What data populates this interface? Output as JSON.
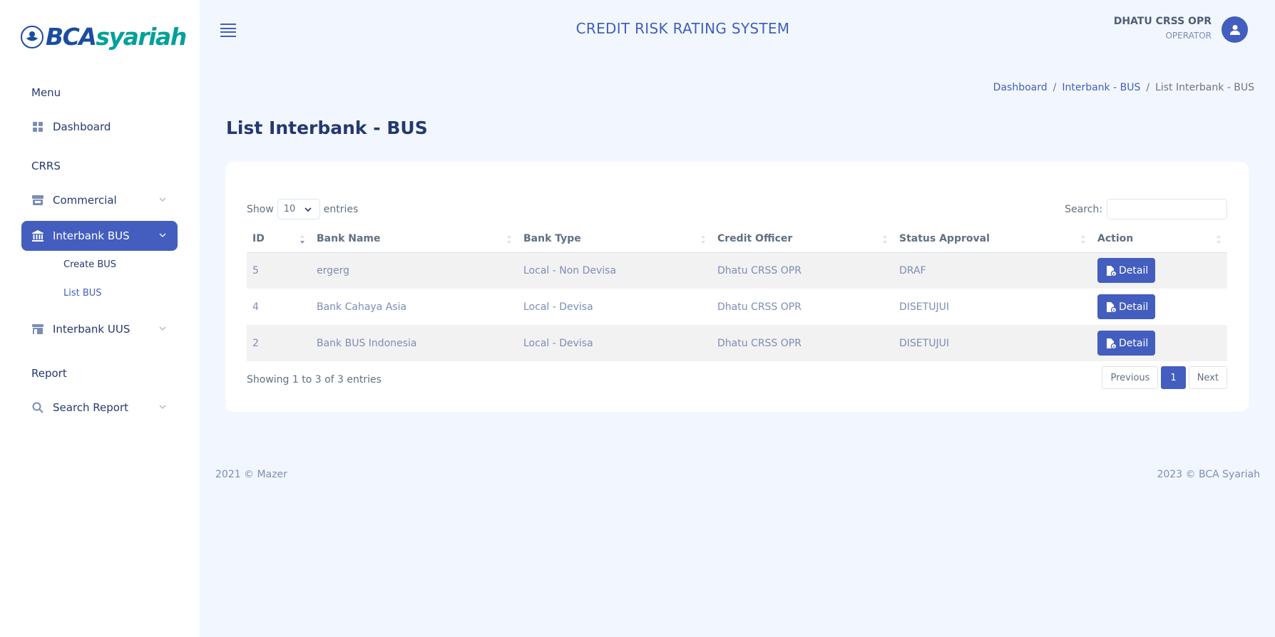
{
  "brand": {
    "bca": "BCA",
    "syariah": "syariah"
  },
  "header": {
    "title": "CREDIT RISK RATING SYSTEM",
    "user_name": "DHATU CRSS OPR",
    "user_role": "OPERATOR"
  },
  "sidebar": {
    "section_menu": "Menu",
    "dashboard": "Dashboard",
    "section_crrs": "CRRS",
    "commercial": "Commercial",
    "interbank_bus": "Interbank BUS",
    "create_bus": "Create BUS",
    "list_bus": "List BUS",
    "interbank_uus": "Interbank UUS",
    "section_report": "Report",
    "search_report": "Search Report"
  },
  "breadcrumb": {
    "item1": "Dashboard",
    "sep": "/",
    "item2": "Interbank - BUS",
    "item3": "List Interbank - BUS"
  },
  "page_title": "List Interbank - BUS",
  "table_controls": {
    "show": "Show",
    "entries_value": "10",
    "entries": "entries",
    "search_label": "Search:"
  },
  "table": {
    "headers": [
      "ID",
      "Bank Name",
      "Bank Type",
      "Credit Officer",
      "Status Approval",
      "Action"
    ],
    "rows": [
      {
        "id": "5",
        "bank_name": "ergerg",
        "bank_type": "Local - Non Devisa",
        "officer": "Dhatu CRSS OPR",
        "status": "DRAF",
        "action": "Detail"
      },
      {
        "id": "4",
        "bank_name": "Bank Cahaya Asia",
        "bank_type": "Local - Devisa",
        "officer": "Dhatu CRSS OPR",
        "status": "DISETUJUI",
        "action": "Detail"
      },
      {
        "id": "2",
        "bank_name": "Bank BUS Indonesia",
        "bank_type": "Local - Devisa",
        "officer": "Dhatu CRSS OPR",
        "status": "DISETUJUI",
        "action": "Detail"
      }
    ]
  },
  "table_info": "Showing 1 to 3 of 3 entries",
  "pagination": {
    "previous": "Previous",
    "page": "1",
    "next": "Next"
  },
  "footer": {
    "left": "2021 © Mazer",
    "right": "2023 © BCA Syariah"
  },
  "colors": {
    "primary": "#435ebe",
    "background": "#f2f7ff",
    "brand_blue": "#1a4da1",
    "brand_teal": "#00a19a"
  }
}
